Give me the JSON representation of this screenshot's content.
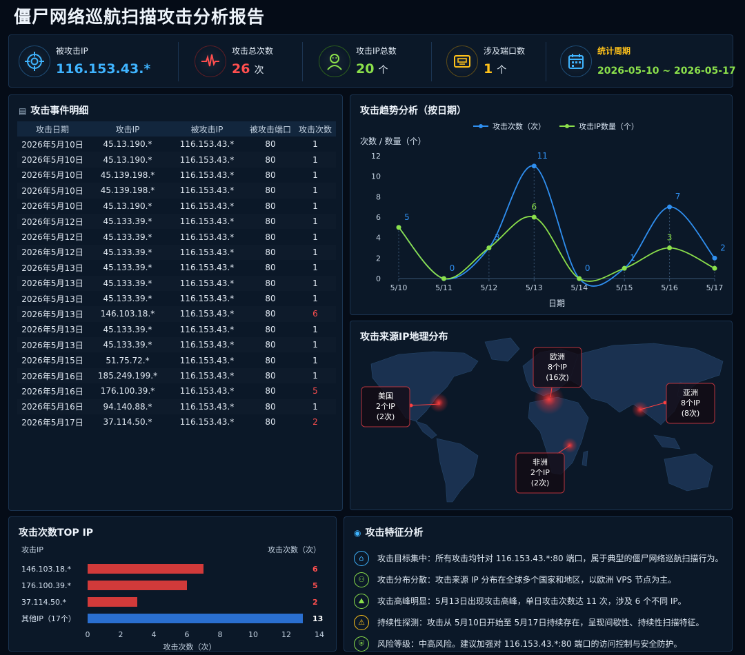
{
  "title": "僵尸网络巡航扫描攻击分析报告",
  "kpis": [
    {
      "label": "被攻击IP",
      "value": "116.153.43.*",
      "unit": "",
      "color": "#3fb4ff",
      "icon": "target-icon"
    },
    {
      "label": "攻击总次数",
      "value": "26",
      "unit": "次",
      "color": "#ff4f4f",
      "icon": "heartbeat-icon"
    },
    {
      "label": "攻击IP总数",
      "value": "20",
      "unit": "个",
      "color": "#8be04b",
      "icon": "hacker-icon"
    },
    {
      "label": "涉及端口数",
      "value": "1",
      "unit": "个",
      "color": "#ffc21a",
      "icon": "port-icon"
    },
    {
      "label": "统计周期",
      "value": "2026-05-10 ~ 2026-05-17",
      "unit": "",
      "color": "#8be04b",
      "icon": "calendar-icon"
    }
  ],
  "events": {
    "title": "攻击事件明细",
    "columns": [
      "攻击日期",
      "攻击IP",
      "被攻击IP",
      "被攻击端口",
      "攻击次数"
    ],
    "rows": [
      [
        "2026年5月10日",
        "45.13.190.*",
        "116.153.43.*",
        "80",
        "1"
      ],
      [
        "2026年5月10日",
        "45.13.190.*",
        "116.153.43.*",
        "80",
        "1"
      ],
      [
        "2026年5月10日",
        "45.139.198.*",
        "116.153.43.*",
        "80",
        "1"
      ],
      [
        "2026年5月10日",
        "45.139.198.*",
        "116.153.43.*",
        "80",
        "1"
      ],
      [
        "2026年5月10日",
        "45.13.190.*",
        "116.153.43.*",
        "80",
        "1"
      ],
      [
        "2026年5月12日",
        "45.133.39.*",
        "116.153.43.*",
        "80",
        "1"
      ],
      [
        "2026年5月12日",
        "45.133.39.*",
        "116.153.43.*",
        "80",
        "1"
      ],
      [
        "2026年5月12日",
        "45.133.39.*",
        "116.153.43.*",
        "80",
        "1"
      ],
      [
        "2026年5月13日",
        "45.133.39.*",
        "116.153.43.*",
        "80",
        "1"
      ],
      [
        "2026年5月13日",
        "45.133.39.*",
        "116.153.43.*",
        "80",
        "1"
      ],
      [
        "2026年5月13日",
        "45.133.39.*",
        "116.153.43.*",
        "80",
        "1"
      ],
      [
        "2026年5月13日",
        "146.103.18.*",
        "116.153.43.*",
        "80",
        "6"
      ],
      [
        "2026年5月13日",
        "45.133.39.*",
        "116.153.43.*",
        "80",
        "1"
      ],
      [
        "2026年5月13日",
        "45.133.39.*",
        "116.153.43.*",
        "80",
        "1"
      ],
      [
        "2026年5月15日",
        "51.75.72.*",
        "116.153.43.*",
        "80",
        "1"
      ],
      [
        "2026年5月16日",
        "185.249.199.*",
        "116.153.43.*",
        "80",
        "1"
      ],
      [
        "2026年5月16日",
        "176.100.39.*",
        "116.153.43.*",
        "80",
        "5"
      ],
      [
        "2026年5月16日",
        "94.140.88.*",
        "116.153.43.*",
        "80",
        "1"
      ],
      [
        "2026年5月17日",
        "37.114.50.*",
        "116.153.43.*",
        "80",
        "2"
      ]
    ]
  },
  "trend": {
    "title": "攻击趋势分析（按日期）",
    "ylabel": "次数 / 数量（个）",
    "xlabel": "日期"
  },
  "map": {
    "title": "攻击来源IP地理分布",
    "regions": [
      {
        "name": "美国",
        "ips": "2个IP",
        "count": "(2次)"
      },
      {
        "name": "欧洲",
        "ips": "8个IP",
        "count": "(16次)"
      },
      {
        "name": "亚洲",
        "ips": "8个IP",
        "count": "(8次)"
      },
      {
        "name": "非洲",
        "ips": "2个IP",
        "count": "(2次)"
      }
    ]
  },
  "topip": {
    "title": "攻击次数TOP IP",
    "col_left": "攻击IP",
    "col_right": "攻击次数（次）"
  },
  "features": {
    "title": "攻击特征分析",
    "items": [
      {
        "text": "攻击目标集中：所有攻击均针对 116.153.43.*:80 端口，属于典型的僵尸网络巡航扫描行为。",
        "icon": "target-building-icon",
        "color": "#3fb4ff"
      },
      {
        "text": "攻击分布分散：攻击来源 IP 分布在全球多个国家和地区，以欧洲 VPS 节点为主。",
        "icon": "network-icon",
        "color": "#8be04b"
      },
      {
        "text": "攻击高峰明显：5月13日出现攻击高峰，单日攻击次数达 11 次，涉及 6 个不同 IP。",
        "icon": "peak-icon",
        "color": "#8be04b"
      },
      {
        "text": "持续性探测：攻击从 5月10日开始至 5月17日持续存在，呈现间歇性、持续性扫描特征。",
        "icon": "persistence-icon",
        "color": "#ffc21a"
      },
      {
        "text": "风险等级：中高风险。建议加强对 116.153.43.*:80 端口的访问控制与安全防护。",
        "icon": "shield-icon",
        "color": "#8be04b"
      }
    ]
  },
  "chart_data": [
    {
      "type": "line",
      "title": "攻击趋势分析（按日期）",
      "xlabel": "日期",
      "ylabel": "次数 / 数量（个）",
      "x": [
        "5/10",
        "5/11",
        "5/12",
        "5/13",
        "5/14",
        "5/15",
        "5/16",
        "5/17"
      ],
      "ylim": [
        0,
        12
      ],
      "yticks": [
        0,
        2,
        4,
        6,
        8,
        10,
        12
      ],
      "legend": "top",
      "series": [
        {
          "name": "攻击次数（次）",
          "color": "#2f8ff0",
          "values": [
            5,
            0,
            3,
            11,
            0,
            1,
            7,
            2
          ],
          "labels": [
            true,
            true,
            true,
            true,
            true,
            true,
            true,
            true
          ]
        },
        {
          "name": "攻击IP数量（个）",
          "color": "#8be04b",
          "values": [
            5,
            0,
            3,
            6,
            0,
            1,
            3,
            1
          ],
          "labels": [
            false,
            false,
            false,
            true,
            false,
            false,
            true,
            false
          ]
        }
      ]
    },
    {
      "type": "bar",
      "title": "攻击次数TOP IP",
      "orientation": "horizontal",
      "categories": [
        "146.103.18.*",
        "176.100.39.*",
        "37.114.50.*",
        "其他IP（17个）"
      ],
      "values": [
        6,
        5,
        2,
        13
      ],
      "bar_values": [
        7,
        6,
        3,
        13
      ],
      "colors": [
        "#ff4f4f",
        "#ff4f4f",
        "#ff4f4f",
        "#ffffff"
      ],
      "bar_colors": [
        "#d23a3a",
        "#d23a3a",
        "#d23a3a",
        "#2a6fd0"
      ],
      "xlabel": "攻击次数（次）",
      "xlim": [
        0,
        14
      ],
      "xticks": [
        0,
        2,
        4,
        6,
        8,
        10,
        12,
        14
      ]
    }
  ]
}
